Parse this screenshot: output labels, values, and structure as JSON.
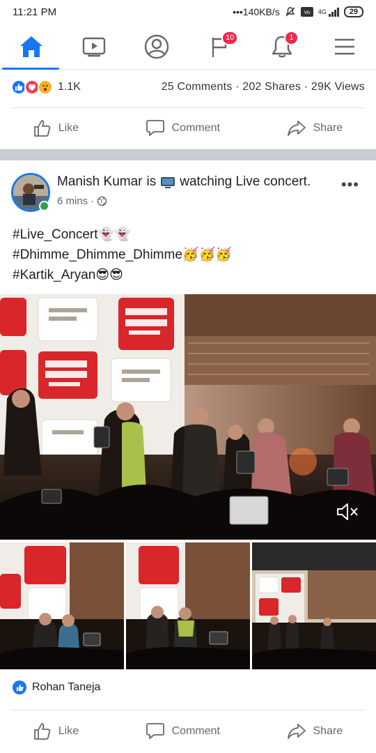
{
  "status_bar": {
    "time": "11:21 PM",
    "network_speed": "140KB/s",
    "network_type": "4G",
    "battery": "29"
  },
  "nav": {
    "items": [
      {
        "icon": "home-icon",
        "active": true
      },
      {
        "icon": "video-icon",
        "active": false
      },
      {
        "icon": "profile-icon",
        "active": false
      },
      {
        "icon": "flag-icon",
        "badge": "10"
      },
      {
        "icon": "bell-icon",
        "badge": "1"
      },
      {
        "icon": "menu-icon",
        "active": false
      }
    ]
  },
  "prev_post": {
    "reaction_count": "1.1K",
    "stats": "25 Comments · 202 Shares · 29K Views",
    "actions": {
      "like": "Like",
      "comment": "Comment",
      "share": "Share"
    }
  },
  "post": {
    "author": "Manish Kumar",
    "activity_prefix": "is",
    "activity": "watching Live concert.",
    "time": "6 mins",
    "privacy_icon": "globe-icon",
    "text_lines": [
      {
        "text": "#Live_Concert",
        "emoji": "👻👻"
      },
      {
        "text": "#Dhimme_Dhimme_Dhimme",
        "emoji": "🥳🥳🥳"
      },
      {
        "text": "#Kartik_Aryan",
        "emoji": "😎😎"
      }
    ],
    "liked_by": "Rohan Taneja",
    "actions": {
      "like": "Like",
      "comment": "Comment",
      "share": "Share"
    }
  },
  "colors": {
    "accent": "#1877f2",
    "badge": "#f02849",
    "online": "#31a24c"
  }
}
